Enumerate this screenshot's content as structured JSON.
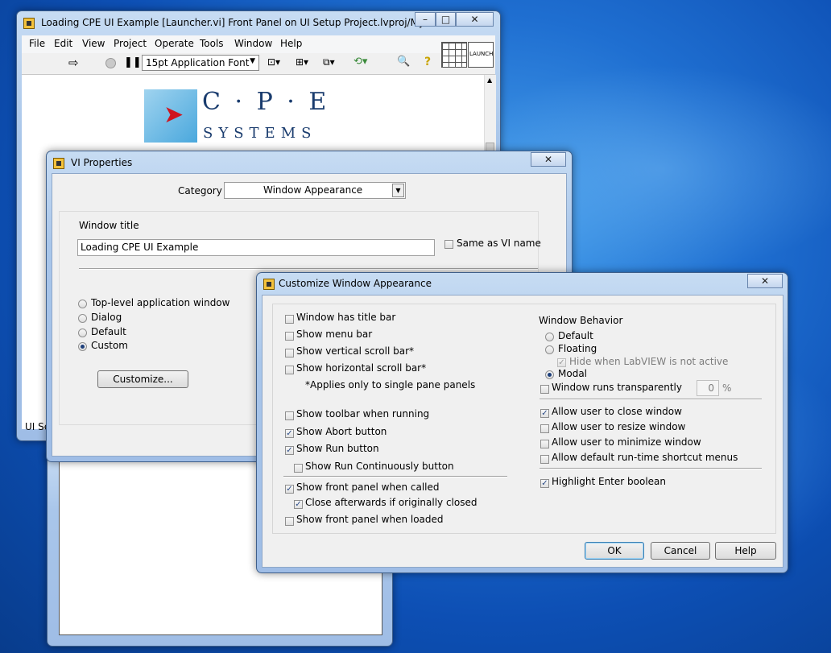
{
  "main_window": {
    "title": "Loading CPE UI Example [Launcher.vi] Front Panel on UI Setup Project.lvproj/My Com...",
    "menu": [
      "File",
      "Edit",
      "View",
      "Project",
      "Operate",
      "Tools",
      "Window",
      "Help"
    ],
    "font_selector": "15pt Application Font",
    "logo_letters": "C · P · E",
    "logo_sub": "SYSTEMS",
    "connector_label": "LAUNCH",
    "status_fragment": "UI Se"
  },
  "vi_properties": {
    "title": "VI Properties",
    "category_label": "Category",
    "category_value": "Window Appearance",
    "window_title_label": "Window title",
    "window_title_value": "Loading CPE UI Example",
    "same_as_vi_name": "Same as VI name",
    "radio_options": [
      {
        "label": "Top-level application window",
        "selected": false
      },
      {
        "label": "Dialog",
        "selected": false
      },
      {
        "label": "Default",
        "selected": false
      },
      {
        "label": "Custom",
        "selected": true
      }
    ],
    "customize_button": "Customize..."
  },
  "customize_dialog": {
    "title": "Customize Window Appearance",
    "left_options": [
      {
        "label": "Window has title bar",
        "checked": false
      },
      {
        "label": "Show menu bar",
        "checked": false
      },
      {
        "label": "Show vertical scroll bar*",
        "checked": false
      },
      {
        "label": "Show horizontal scroll bar*",
        "checked": false
      }
    ],
    "note": "*Applies only to single pane panels",
    "toolbar_options": [
      {
        "label": "Show toolbar when running",
        "checked": false
      },
      {
        "label": "Show Abort button",
        "checked": true
      },
      {
        "label": "Show Run button",
        "checked": true
      },
      {
        "label": "Show Run Continuously button",
        "checked": false
      }
    ],
    "panel_options": [
      {
        "label": "Show front panel when called",
        "checked": true
      },
      {
        "label": "Close afterwards if originally closed",
        "checked": true
      },
      {
        "label": "Show front panel when loaded",
        "checked": false
      }
    ],
    "window_behavior_label": "Window Behavior",
    "behavior_radios": [
      {
        "label": "Default",
        "selected": false
      },
      {
        "label": "Floating",
        "selected": false
      },
      {
        "label": "Modal",
        "selected": true
      }
    ],
    "hide_when_inactive": "Hide when LabVIEW is not active",
    "transparent_label": "Window runs transparently",
    "transparency_value": "0",
    "transparency_unit": "%",
    "permission_options": [
      {
        "label": "Allow user to close window",
        "checked": true
      },
      {
        "label": "Allow user to resize window",
        "checked": false
      },
      {
        "label": "Allow user to minimize window",
        "checked": false
      },
      {
        "label": "Allow default run-time shortcut menus",
        "checked": false
      }
    ],
    "highlight_enter": "Highlight Enter boolean",
    "buttons": {
      "ok": "OK",
      "cancel": "Cancel",
      "help": "Help"
    }
  },
  "colors": {
    "desktop_blue": "#1f6fd1",
    "dialog_face": "#f0f0f0",
    "accent": "#2b4c88"
  }
}
